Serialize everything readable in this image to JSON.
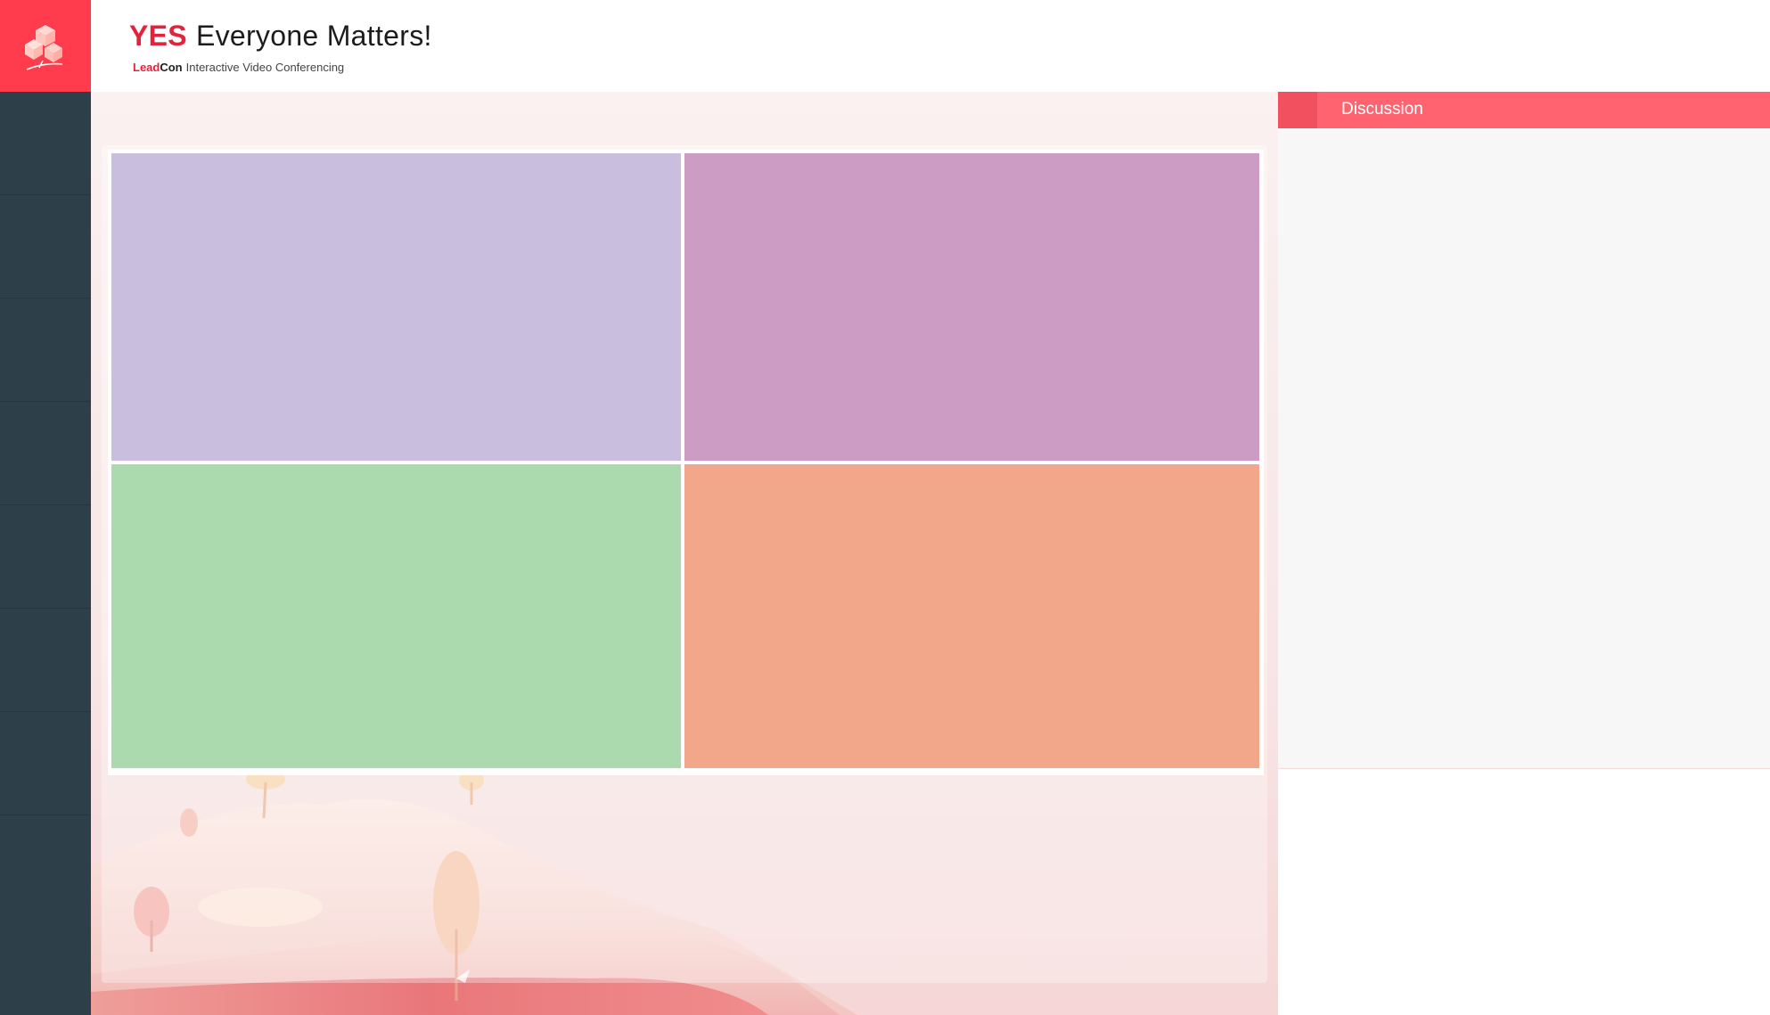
{
  "header": {
    "title_emphasis": "YES",
    "title_rest": "Everyone Matters!",
    "brand_lead": "Lead",
    "brand_con": "Con",
    "subtitle_rest": "Interactive Video Conferencing"
  },
  "sidebar": {
    "item_count": 8
  },
  "video_tiles": [
    {
      "color": "#c9bedd"
    },
    {
      "color": "#cd9cc4"
    },
    {
      "color": "#abdaae"
    },
    {
      "color": "#f2a78a"
    }
  ],
  "discussion": {
    "title": "Discussion"
  },
  "colors": {
    "brand": "#ff3b4e",
    "title_accent": "#e4223c",
    "sidebar": "#2d3f48",
    "discussion_header": "#ff6370"
  }
}
